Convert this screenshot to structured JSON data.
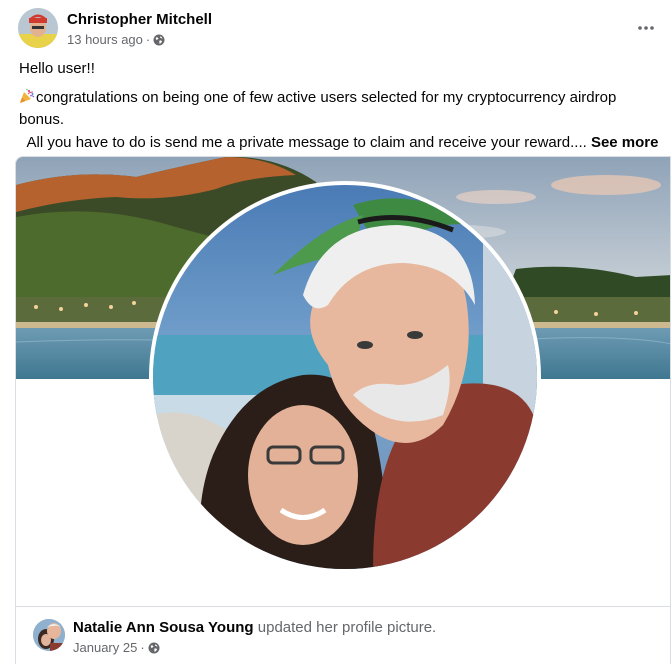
{
  "post": {
    "author": "Christopher Mitchell",
    "timestamp": "13 hours ago",
    "separator": "·",
    "audience_icon": "globe-icon",
    "more_icon": "more-options-icon",
    "greeting": "Hello user!!",
    "emoji": "party-popper-icon",
    "line1": "congratulations on being one of few active users selected for  my cryptocurrency airdrop bonus.",
    "line2": "  All you have to do is send me a private message to claim and receive your reward....",
    "see_more": "See more"
  },
  "shared": {
    "name": "Natalie Ann Sousa Young",
    "action": "updated her profile picture.",
    "date": "January 25",
    "separator": "·",
    "audience_icon": "globe-icon"
  },
  "colors": {
    "text_primary": "#050505",
    "text_secondary": "#65676b",
    "divider": "#dadde1"
  }
}
